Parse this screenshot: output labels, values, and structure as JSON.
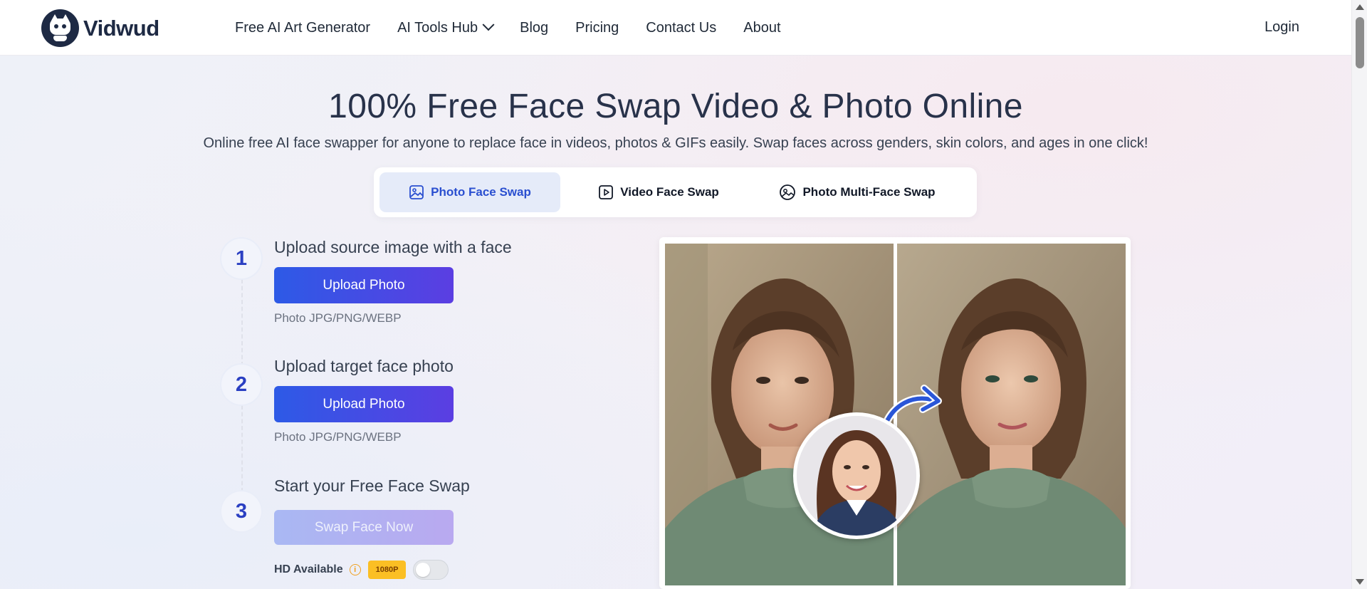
{
  "brand": {
    "name": "Vidwud"
  },
  "nav": {
    "items": [
      {
        "label": "Free AI Art Generator"
      },
      {
        "label": "AI Tools Hub"
      },
      {
        "label": "Blog"
      },
      {
        "label": "Pricing"
      },
      {
        "label": "Contact Us"
      },
      {
        "label": "About"
      }
    ],
    "login": "Login"
  },
  "hero": {
    "title": "100% Free Face Swap Video & Photo Online",
    "subtitle": "Online free AI face swapper for anyone to replace face in videos, photos & GIFs easily. Swap faces across genders, skin colors, and ages in one click!"
  },
  "tabs": [
    {
      "label": "Photo Face Swap",
      "icon": "image-icon",
      "active": true
    },
    {
      "label": "Video Face Swap",
      "icon": "video-icon",
      "active": false
    },
    {
      "label": "Photo Multi-Face Swap",
      "icon": "multi-face-icon",
      "active": false
    }
  ],
  "steps": [
    {
      "number": "1",
      "label": "Upload source image with a face",
      "button": "Upload Photo",
      "note": "Photo JPG/PNG/WEBP"
    },
    {
      "number": "2",
      "label": "Upload target face photo",
      "button": "Upload Photo",
      "note": "Photo JPG/PNG/WEBP"
    },
    {
      "number": "3",
      "label": "Start your Free Face Swap",
      "button": "Swap Face Now"
    }
  ],
  "hd": {
    "label": "HD Available",
    "info": "i",
    "badge": "1080P",
    "enabled": false
  },
  "colors": {
    "accent": "#2d5ae6",
    "accent_end": "#5b3ee2",
    "step_number": "#2a3fc2",
    "active_tab_bg": "#e5ebf9",
    "badge": "#fbbf24"
  }
}
